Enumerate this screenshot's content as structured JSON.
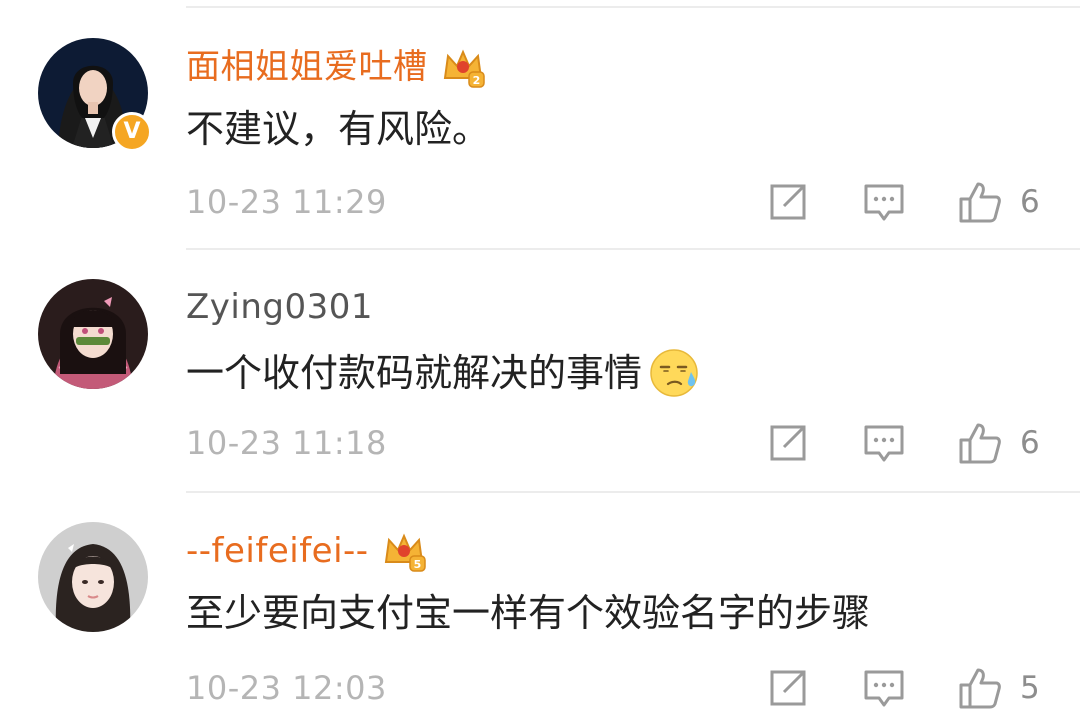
{
  "comments": [
    {
      "username": "面相姐姐爱吐槽",
      "username_color": "#e86c1f",
      "verified": true,
      "verified_mark": "V",
      "member_level": "2",
      "content": "不建议，有风险。",
      "time": "10-23 11:29",
      "likes": "6",
      "avatar": "woman-with-dark-hair-in-suit",
      "emoji": null
    },
    {
      "username": "Zying0301",
      "username_color": "#555555",
      "verified": false,
      "member_level": null,
      "content": "一个收付款码就解决的事情",
      "time": "10-23 11:18",
      "likes": "6",
      "avatar": "anime-girl-with-bamboo-muzzle",
      "emoji": "sweat-emoji"
    },
    {
      "username": "--feifeifei--",
      "username_color": "#e86c1f",
      "verified": false,
      "member_level": "5",
      "content": "至少要向支付宝一样有个效验名字的步骤",
      "time": "10-23 12:03",
      "likes": "5",
      "avatar": "girl-with-long-hair-selfie",
      "emoji": null
    }
  ],
  "icons": {
    "repost": "repost-icon",
    "comment": "comment-icon",
    "like": "thumbs-up-icon"
  },
  "colors": {
    "text": "#222222",
    "meta": "#b5b5b5",
    "icon": "#9a9a9a",
    "vip_orange": "#e86c1f",
    "verified_badge": "#f5a623",
    "divider": "#ececec"
  }
}
